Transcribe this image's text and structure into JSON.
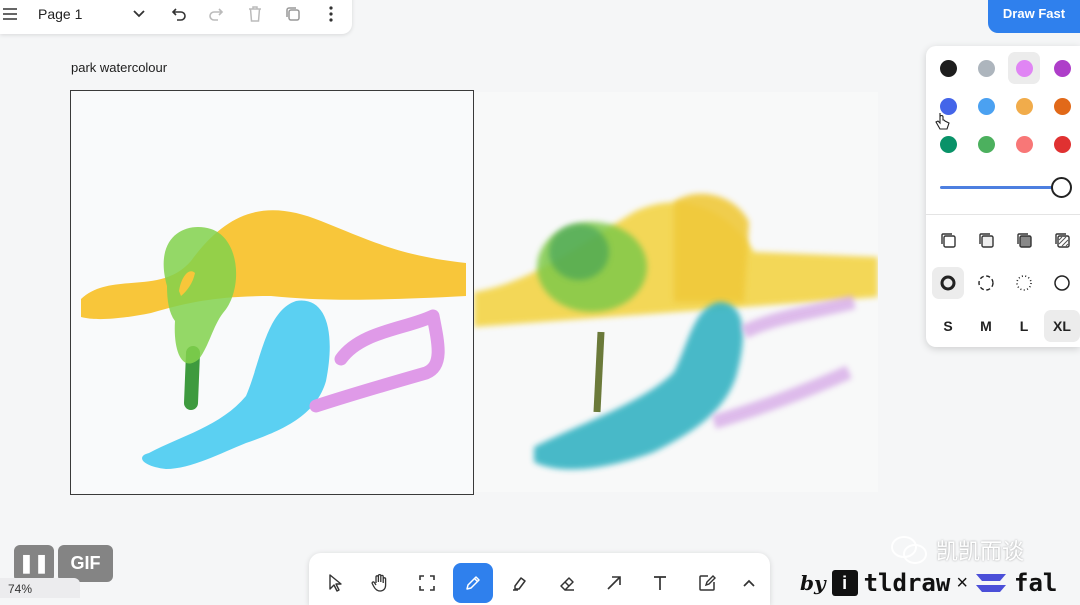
{
  "menu": {
    "page_name": "Page 1"
  },
  "draw_fast_label": "Draw Fast",
  "frame": {
    "label": "park watercolour"
  },
  "style_panel": {
    "colors": [
      "#1d1d1d",
      "#adb5bd",
      "#e085f4",
      "#ae3ec9",
      "#4465e9",
      "#4ba1f1",
      "#f1ac4b",
      "#e16919",
      "#099268",
      "#4cb05e",
      "#f87777",
      "#e03131"
    ],
    "selected_color": "#e085f4",
    "sizes": [
      "S",
      "M",
      "L",
      "XL"
    ],
    "selected_size": "XL"
  },
  "overlay": {
    "pause_symbol": "❚❚",
    "gif_label": "GIF",
    "zoom": "74%",
    "watermark": "凯凯而谈",
    "by": "by",
    "tldraw_logo": "i",
    "tldraw": "tldraw",
    "times": "×",
    "fal": "fal"
  }
}
